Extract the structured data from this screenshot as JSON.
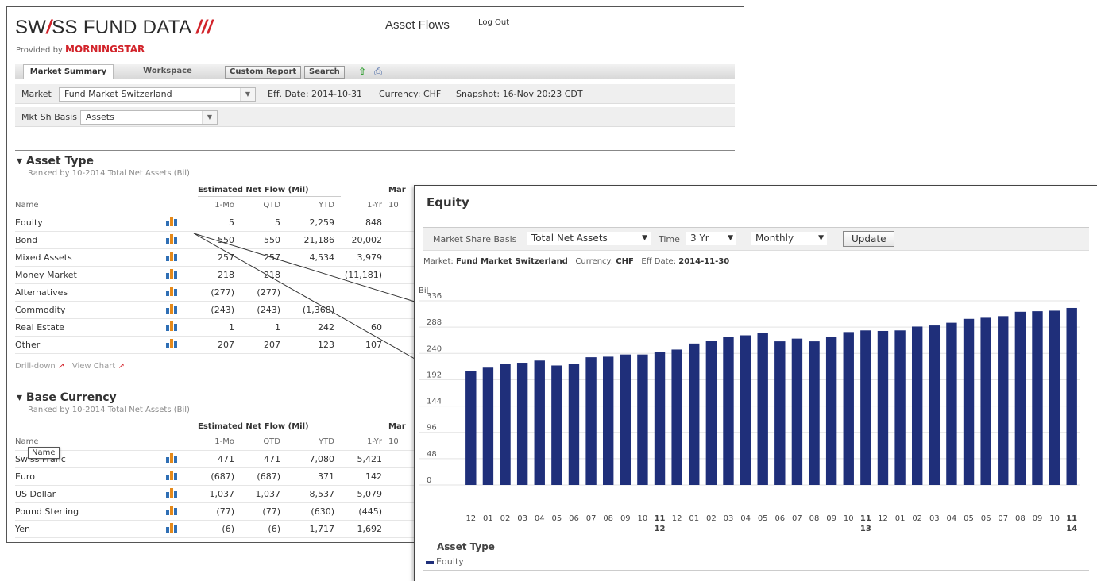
{
  "brand": {
    "logo_a": "SW",
    "logo_slash": "/",
    "logo_b": "SS FUND DATA",
    "logo_bars": "///",
    "provided_by": "Provided by",
    "morningstar": "MORNINGSTAR"
  },
  "header": {
    "title": "Asset Flows",
    "logout": "Log Out"
  },
  "tabs": {
    "market_summary": "Market Summary",
    "workspace": "Workspace",
    "custom_report": "Custom Report",
    "search": "Search"
  },
  "market_row": {
    "label": "Market",
    "value": "Fund Market Switzerland",
    "eff_date": "Eff. Date: 2014-10-31",
    "currency": "Currency: CHF",
    "snapshot": "Snapshot: 16-Nov 20:23 CDT"
  },
  "mktsh_row": {
    "label": "Mkt Sh Basis",
    "value": "Assets"
  },
  "asset_type": {
    "title": "Asset Type",
    "subtitle": "Ranked by 10-2014 Total Net Assets (Bil)",
    "group_header": "Estimated Net Flow (Mil)",
    "cut_header": "Mar",
    "cols": {
      "name": "Name",
      "mo": "1-Mo",
      "qtd": "QTD",
      "ytd": "YTD",
      "yr": "1-Yr",
      "cut": "10"
    },
    "rows": [
      {
        "name": "Equity",
        "mo": "5",
        "qtd": "5",
        "ytd": "2,259",
        "yr": "848"
      },
      {
        "name": "Bond",
        "mo": "550",
        "qtd": "550",
        "ytd": "21,186",
        "yr": "20,002"
      },
      {
        "name": "Mixed Assets",
        "mo": "257",
        "qtd": "257",
        "ytd": "4,534",
        "yr": "3,979"
      },
      {
        "name": "Money Market",
        "mo": "218",
        "qtd": "218",
        "ytd": "",
        "yr": "(11,181)"
      },
      {
        "name": "Alternatives",
        "mo": "(277)",
        "qtd": "(277)",
        "ytd": "",
        "yr": ""
      },
      {
        "name": "Commodity",
        "mo": "(243)",
        "qtd": "(243)",
        "ytd": "(1,368)",
        "yr": ""
      },
      {
        "name": "Real Estate",
        "mo": "1",
        "qtd": "1",
        "ytd": "242",
        "yr": "60"
      },
      {
        "name": "Other",
        "mo": "207",
        "qtd": "207",
        "ytd": "123",
        "yr": "107"
      }
    ],
    "drilldown": "Drill-down",
    "viewchart": "View Chart"
  },
  "base_currency": {
    "title": "Base Currency",
    "subtitle": "Ranked by 10-2014 Total Net Assets (Bil)",
    "group_header": "Estimated Net Flow (Mil)",
    "cut_header": "Mar",
    "cols": {
      "name": "Name",
      "mo": "1-Mo",
      "qtd": "QTD",
      "ytd": "YTD",
      "yr": "1-Yr",
      "cut": "10"
    },
    "tooltip": "Name",
    "rows": [
      {
        "name": "Swiss Franc",
        "mo": "471",
        "qtd": "471",
        "ytd": "7,080",
        "yr": "5,421"
      },
      {
        "name": "Euro",
        "mo": "(687)",
        "qtd": "(687)",
        "ytd": "371",
        "yr": "142"
      },
      {
        "name": "US Dollar",
        "mo": "1,037",
        "qtd": "1,037",
        "ytd": "8,537",
        "yr": "5,079"
      },
      {
        "name": "Pound Sterling",
        "mo": "(77)",
        "qtd": "(77)",
        "ytd": "(630)",
        "yr": "(445)"
      },
      {
        "name": "Yen",
        "mo": "(6)",
        "qtd": "(6)",
        "ytd": "1,717",
        "yr": "1,692"
      }
    ]
  },
  "panel": {
    "title": "Equity",
    "basis_label": "Market Share Basis",
    "basis_value": "Total Net Assets",
    "time_label": "Time",
    "time_value": "3 Yr",
    "freq_value": "Monthly",
    "update": "Update",
    "meta_market": "Market:",
    "meta_market_value": "Fund Market Switzerland",
    "meta_currency": "Currency:",
    "meta_currency_value": "CHF",
    "meta_eff": "Eff Date:",
    "meta_eff_value": "2014-11-30",
    "legend_title": "Asset Type",
    "legend_item": "Equity"
  },
  "colors": {
    "bar": "#1f2f7a",
    "accent": "#d2232a",
    "icon_blue": "#2f6fb5",
    "icon_orange": "#e58a1b"
  },
  "chart_data": {
    "type": "bar",
    "ylabel": "Bil",
    "ylim": [
      0,
      336
    ],
    "yticks": [
      0,
      48,
      96,
      144,
      192,
      240,
      288,
      336
    ],
    "grid": true,
    "categories": [
      "12",
      "01",
      "02",
      "03",
      "04",
      "05",
      "06",
      "07",
      "08",
      "09",
      "10",
      "11",
      "12",
      "01",
      "02",
      "03",
      "04",
      "05",
      "06",
      "07",
      "08",
      "09",
      "10",
      "11",
      "12",
      "01",
      "02",
      "03",
      "04",
      "05",
      "06",
      "07",
      "08",
      "09",
      "10",
      "11"
    ],
    "year_labels": {
      "11": "12",
      "23": "13",
      "35": "14"
    },
    "series": [
      {
        "name": "Equity",
        "values": [
          208,
          214,
          221,
          223,
          227,
          218,
          221,
          233,
          234,
          238,
          238,
          242,
          247,
          258,
          263,
          270,
          273,
          278,
          262,
          267,
          262,
          270,
          279,
          282,
          281,
          282,
          289,
          291,
          296,
          303,
          305,
          308,
          316,
          317,
          318,
          323
        ]
      }
    ]
  }
}
